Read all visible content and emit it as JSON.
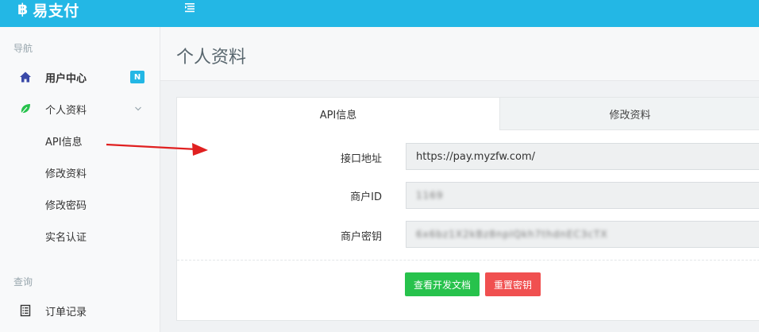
{
  "brand": {
    "logo": "฿",
    "name": "易支付"
  },
  "sidebar": {
    "section_nav": "导航",
    "section_query": "查询",
    "items": [
      {
        "label": "用户中心",
        "icon": "home-icon",
        "badge": "N"
      },
      {
        "label": "个人资料",
        "icon": "leaf-icon"
      },
      {
        "label": "API信息"
      },
      {
        "label": "修改资料"
      },
      {
        "label": "修改密码"
      },
      {
        "label": "实名认证"
      },
      {
        "label": "订单记录",
        "icon": "list-icon"
      }
    ]
  },
  "page": {
    "title": "个人资料"
  },
  "tabs": [
    {
      "label": "API信息",
      "active": true
    },
    {
      "label": "修改资料",
      "active": false
    }
  ],
  "form": {
    "fields": [
      {
        "label": "接口地址",
        "value": "https://pay.myzfw.com/"
      },
      {
        "label": "商户ID",
        "value": "1169"
      },
      {
        "label": "商户密钥",
        "value": "6x6bz1X2kBz8npIQkh7thdnEC3cTX"
      }
    ],
    "docs_button": "查看开发文档",
    "reset_button": "重置密钥"
  },
  "colors": {
    "brand": "#23b7e5",
    "green": "#27c24c",
    "red": "#f05050",
    "arrow": "#e02020"
  }
}
